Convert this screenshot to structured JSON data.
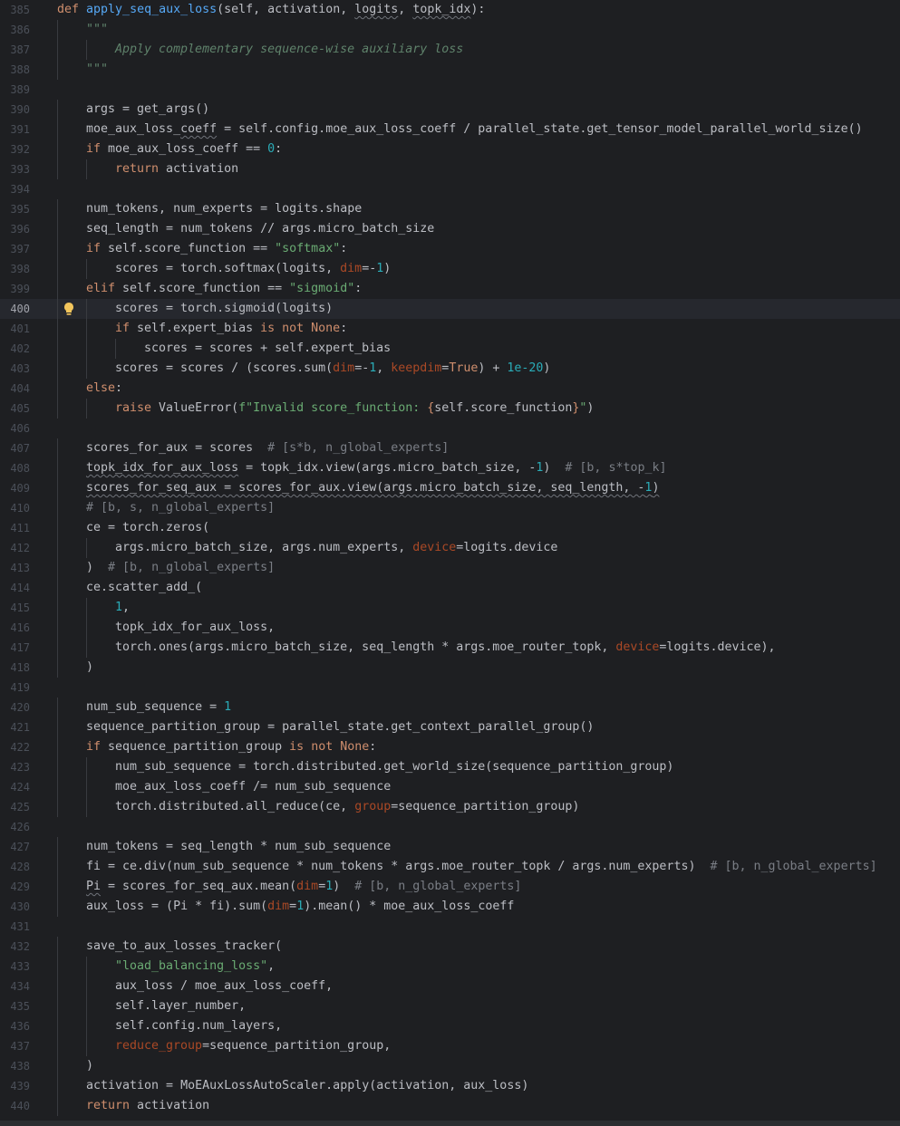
{
  "editor": {
    "current_line": "400",
    "lines": [
      {
        "n": "385",
        "indent": 0,
        "html": "<span class=\"kw\">def </span><span class=\"fn\">apply_seq_aux_loss</span>(self, activation, <span class=\"wavy\">logits</span>, <span class=\"wavy\">topk_idx</span>):"
      },
      {
        "n": "386",
        "indent": 1,
        "html": "<span class=\"doc\">\"\"\"</span>"
      },
      {
        "n": "387",
        "indent": 2,
        "html": "<span class=\"doc\">Apply complementary sequence-wise auxiliary loss</span>"
      },
      {
        "n": "388",
        "indent": 1,
        "html": "<span class=\"doc\">\"\"\"</span>"
      },
      {
        "n": "389",
        "indent": 0,
        "html": ""
      },
      {
        "n": "390",
        "indent": 1,
        "html": "args = get_args()"
      },
      {
        "n": "391",
        "indent": 1,
        "html": "moe_aux_loss_<span class=\"wavy\">coeff</span> = self.config.moe_aux_loss_coeff / parallel_state.get_tensor_model_parallel_world_size()"
      },
      {
        "n": "392",
        "indent": 1,
        "html": "<span class=\"kw\">if </span>moe_aux_loss_coeff == <span class=\"num\">0</span>:"
      },
      {
        "n": "393",
        "indent": 2,
        "html": "<span class=\"kw\">return </span>activation"
      },
      {
        "n": "394",
        "indent": 0,
        "html": ""
      },
      {
        "n": "395",
        "indent": 1,
        "html": "num_tokens, num_experts = logits.shape"
      },
      {
        "n": "396",
        "indent": 1,
        "html": "seq_length = num_tokens // args.micro_batch_size"
      },
      {
        "n": "397",
        "indent": 1,
        "html": "<span class=\"kw\">if </span>self.score_function == <span class=\"str\">\"softmax\"</span>:"
      },
      {
        "n": "398",
        "indent": 2,
        "html": "scores = torch.softmax(logits, <span class=\"kwarg\">dim</span>=-<span class=\"num\">1</span>)"
      },
      {
        "n": "399",
        "indent": 1,
        "html": "<span class=\"kw\">elif </span>self.score_function == <span class=\"str\">\"sigmoid\"</span>:"
      },
      {
        "n": "400",
        "indent": 2,
        "html": "scores = torch.sigmoid(logits)"
      },
      {
        "n": "401",
        "indent": 2,
        "html": "<span class=\"kw\">if </span>self.expert_bias <span class=\"kw\">is not None</span>:"
      },
      {
        "n": "402",
        "indent": 3,
        "html": "scores = scores + self.expert_bias"
      },
      {
        "n": "403",
        "indent": 2,
        "html": "scores = scores / (scores.sum(<span class=\"kwarg\">dim</span>=-<span class=\"num\">1</span>, <span class=\"kwarg\">keepdim</span>=<span class=\"kw\">True</span>) + <span class=\"num\">1e-20</span>)"
      },
      {
        "n": "404",
        "indent": 1,
        "html": "<span class=\"kw\">else</span>:"
      },
      {
        "n": "405",
        "indent": 2,
        "html": "<span class=\"kw\">raise </span>ValueError(<span class=\"str\">f\"Invalid score_function: </span><span class=\"kw\">{</span>self.score_function<span class=\"kw\">}</span><span class=\"str\">\"</span>)"
      },
      {
        "n": "406",
        "indent": 0,
        "html": ""
      },
      {
        "n": "407",
        "indent": 1,
        "html": "scores_for_aux = scores  <span class=\"cmt\"># [s*b, n_global_experts]</span>"
      },
      {
        "n": "408",
        "indent": 1,
        "html": "<span class=\"wavy\">topk_idx_for_aux_loss</span> = topk_idx.view(args.micro_batch_size, -<span class=\"num\">1</span>)  <span class=\"cmt\"># [b, s*top_k]</span>"
      },
      {
        "n": "409",
        "indent": 1,
        "html": "<span class=\"wavy\">scores_for_seq_aux = scores_for_aux.view(args.micro_batch_size, seq_length, -<span class=\"num\">1</span>)</span>"
      },
      {
        "n": "410",
        "indent": 1,
        "html": "<span class=\"cmt\"># [b, s, n_global_experts]</span>"
      },
      {
        "n": "411",
        "indent": 1,
        "html": "ce = torch.zeros("
      },
      {
        "n": "412",
        "indent": 2,
        "html": "args.micro_batch_size, args.num_experts, <span class=\"kwarg\">device</span>=logits.device"
      },
      {
        "n": "413",
        "indent": 1,
        "html": ")  <span class=\"cmt\"># [b, n_global_experts]</span>"
      },
      {
        "n": "414",
        "indent": 1,
        "html": "ce.scatter_add_("
      },
      {
        "n": "415",
        "indent": 2,
        "html": "<span class=\"num\">1</span>,"
      },
      {
        "n": "416",
        "indent": 2,
        "html": "topk_idx_for_aux_loss,"
      },
      {
        "n": "417",
        "indent": 2,
        "html": "torch.ones(args.micro_batch_size, seq_length * args.moe_router_topk, <span class=\"kwarg\">device</span>=logits.device),"
      },
      {
        "n": "418",
        "indent": 1,
        "html": ")"
      },
      {
        "n": "419",
        "indent": 0,
        "html": ""
      },
      {
        "n": "420",
        "indent": 1,
        "html": "num_sub_sequence = <span class=\"num\">1</span>"
      },
      {
        "n": "421",
        "indent": 1,
        "html": "sequence_partition_group = parallel_state.get_context_parallel_group()"
      },
      {
        "n": "422",
        "indent": 1,
        "html": "<span class=\"kw\">if </span>sequence_partition_group <span class=\"kw\">is not None</span>:"
      },
      {
        "n": "423",
        "indent": 2,
        "html": "num_sub_sequence = torch.distributed.get_world_size(sequence_partition_group)"
      },
      {
        "n": "424",
        "indent": 2,
        "html": "moe_aux_loss_coeff /= num_sub_sequence"
      },
      {
        "n": "425",
        "indent": 2,
        "html": "torch.distributed.all_reduce(ce, <span class=\"kwarg\">group</span>=sequence_partition_group)"
      },
      {
        "n": "426",
        "indent": 0,
        "html": ""
      },
      {
        "n": "427",
        "indent": 1,
        "html": "num_tokens = seq_length * num_sub_sequence"
      },
      {
        "n": "428",
        "indent": 1,
        "html": "fi = ce.div(num_sub_sequence * num_tokens * args.moe_router_topk / args.num_experts)  <span class=\"cmt\"># [b, n_global_experts]</span>"
      },
      {
        "n": "429",
        "indent": 1,
        "html": "<span class=\"wavy\">Pi</span> = scores_for_seq_aux.mean(<span class=\"kwarg\">dim</span>=<span class=\"num\">1</span>)  <span class=\"cmt\"># [b, n_global_experts]</span>"
      },
      {
        "n": "430",
        "indent": 1,
        "html": "aux_loss = (Pi * fi).sum(<span class=\"kwarg\">dim</span>=<span class=\"num\">1</span>).mean() * moe_aux_loss_coeff"
      },
      {
        "n": "431",
        "indent": 0,
        "html": ""
      },
      {
        "n": "432",
        "indent": 1,
        "html": "save_to_aux_losses_tracker("
      },
      {
        "n": "433",
        "indent": 2,
        "html": "<span class=\"str\">\"load_balancing_loss\"</span>,"
      },
      {
        "n": "434",
        "indent": 2,
        "html": "aux_loss / moe_aux_loss_coeff,"
      },
      {
        "n": "435",
        "indent": 2,
        "html": "self.layer_number,"
      },
      {
        "n": "436",
        "indent": 2,
        "html": "self.config.num_layers,"
      },
      {
        "n": "437",
        "indent": 2,
        "html": "<span class=\"kwarg\">reduce_group</span>=sequence_partition_group,"
      },
      {
        "n": "438",
        "indent": 1,
        "html": ")"
      },
      {
        "n": "439",
        "indent": 1,
        "html": "activation = MoEAuxLossAutoScaler.apply(activation, aux_loss)"
      },
      {
        "n": "440",
        "indent": 1,
        "html": "<span class=\"kw\">return </span>activation"
      }
    ]
  },
  "colors": {
    "background": "#1e1f22",
    "keyword": "#cf8e6d",
    "function": "#56a8f5",
    "string": "#6aab73",
    "number": "#2aacb8",
    "comment": "#7a7e85",
    "kwarg": "#aa4926"
  },
  "icons": {
    "intention": "lightbulb-icon"
  }
}
